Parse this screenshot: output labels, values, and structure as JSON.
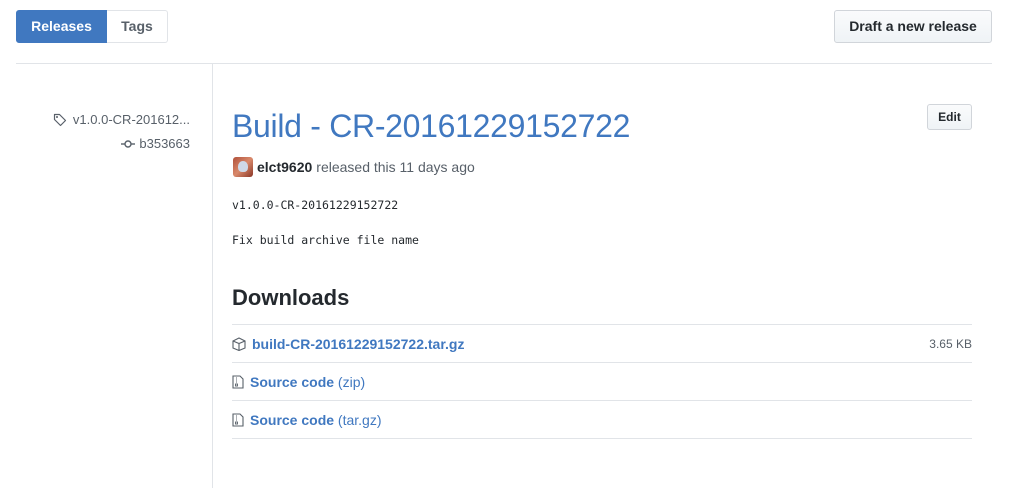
{
  "nav": {
    "releases_label": "Releases",
    "tags_label": "Tags"
  },
  "draft_button_label": "Draft a new release",
  "meta": {
    "tag": "v1.0.0-CR-201612...",
    "commit": "b353663"
  },
  "release": {
    "title": "Build - CR-20161229152722",
    "edit_label": "Edit",
    "author": "elct9620",
    "released_text": "released this 11 days ago",
    "body_line1": "v1.0.0-CR-20161229152722",
    "body_line2": "Fix build archive file name"
  },
  "downloads": {
    "heading": "Downloads",
    "items": [
      {
        "name": "build-CR-20161229152722.tar.gz",
        "suffix": "",
        "size": "3.65 KB",
        "icon": "package-icon"
      },
      {
        "name": "Source code",
        "suffix": "(zip)",
        "size": "",
        "icon": "file-zip-icon"
      },
      {
        "name": "Source code",
        "suffix": "(tar.gz)",
        "size": "",
        "icon": "file-zip-icon"
      }
    ]
  },
  "colors": {
    "accent": "#4078c0",
    "border": "#e1e4e8",
    "muted": "#586069"
  }
}
